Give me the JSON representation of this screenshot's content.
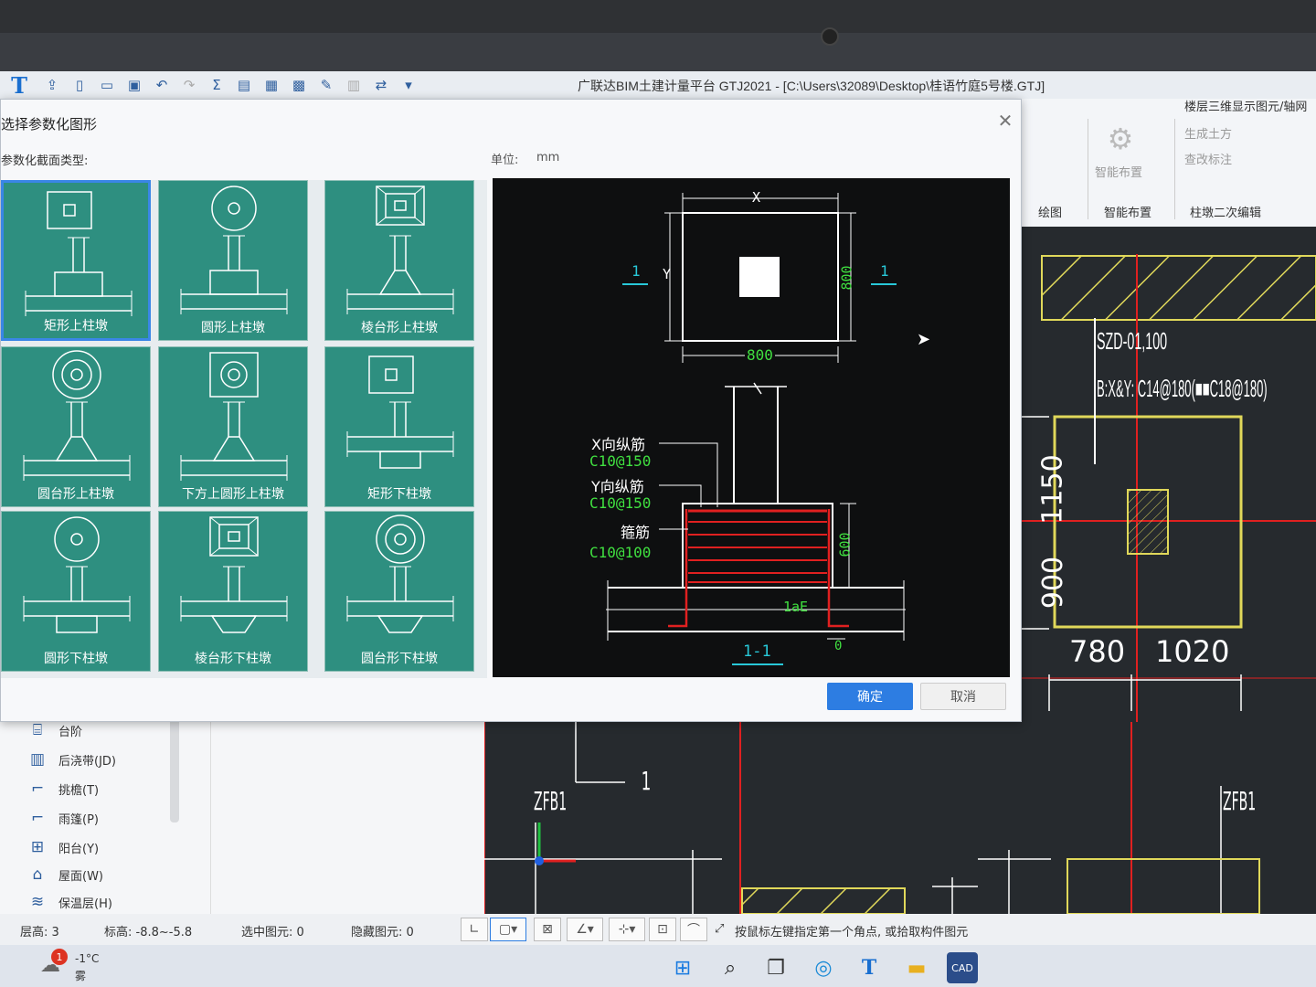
{
  "app": {
    "title": "广联达BIM土建计量平台 GTJ2021 - [C:\\Users\\32089\\Desktop\\桂语竹庭5号楼.GTJ]"
  },
  "ribbon": {
    "right_title": "楼层三维显示图元/轴网",
    "buttons": {
      "generate_earthwork": "生成土方",
      "view_annotation": "查改标注",
      "smart_layout": "智能布置"
    },
    "groups": {
      "draw": "绘图",
      "smart_layout": "智能布置",
      "pier_edit": "柱墩二次编辑"
    }
  },
  "dialog": {
    "title": "选择参数化图形",
    "section_label": "参数化截面类型:",
    "unit_label": "单位:",
    "unit_value": "mm",
    "ok_label": "确定",
    "cancel_label": "取消",
    "tiles": [
      {
        "label": "矩形上柱墩",
        "top": "square",
        "selected": true
      },
      {
        "label": "圆形上柱墩",
        "top": "circle",
        "selected": false
      },
      {
        "label": "棱台形上柱墩",
        "top": "frustum",
        "selected": false
      },
      {
        "label": "圆台形上柱墩",
        "top": "dcircle",
        "selected": false
      },
      {
        "label": "下方上圆形上柱墩",
        "top": "sqcircle",
        "selected": false
      },
      {
        "label": "矩形下柱墩",
        "top": "square",
        "selected": false
      },
      {
        "label": "圆形下柱墩",
        "top": "circle",
        "selected": false
      },
      {
        "label": "棱台形下柱墩",
        "top": "frustum",
        "selected": false
      },
      {
        "label": "圆台形下柱墩",
        "top": "dcircle",
        "selected": false
      }
    ],
    "preview": {
      "dim_x": "X",
      "dim_y": "Y",
      "dim_800_right": "800",
      "dim_800_bottom": "800",
      "section_mark": "1",
      "section_name": "1-1",
      "x_rebar_label": "X向纵筋",
      "x_rebar_value": "C10@150",
      "y_rebar_label": "Y向纵筋",
      "y_rebar_value": "C10@150",
      "stirrup_label": "箍筋",
      "stirrup_value": "C10@100",
      "height": "600",
      "anchorage": "1aE",
      "zero": "0"
    }
  },
  "cad": {
    "label_code": "SZD-01,100",
    "label_rebar": "B:X&Y: C14@180(■■C18@180)",
    "dim_1150": "1150",
    "dim_900": "900",
    "dim_780": "780",
    "dim_1020": "1020",
    "axis_1": "1",
    "zfb_left": "ZFB1",
    "zfb_right": "ZFB1"
  },
  "left_panel": {
    "items": [
      {
        "icon": "steps-icon",
        "label": "台阶"
      },
      {
        "icon": "post-pour-icon",
        "label": "后浇带(JD)"
      },
      {
        "icon": "cantilever-icon",
        "label": "挑檐(T)"
      },
      {
        "icon": "canopy-icon",
        "label": "雨篷(P)"
      },
      {
        "icon": "balcony-icon",
        "label": "阳台(Y)"
      },
      {
        "icon": "roof-icon",
        "label": "屋面(W)"
      },
      {
        "icon": "insulation-icon",
        "label": "保温层(H)"
      }
    ]
  },
  "status": {
    "floor_height": "层高:  3",
    "elevation": "标高:  -8.8~-5.8",
    "selected": "选中图元: 0",
    "hidden": "隐藏图元: 0",
    "hint": "按鼠标左键指定第一个角点, 或拾取构件图元"
  },
  "taskbar": {
    "temperature": "-1°C",
    "weather": "雾",
    "badge": "1"
  },
  "colors": {
    "tile": "#2e8f80",
    "accent": "#2d7de2",
    "cad_bg": "#262a2e"
  }
}
